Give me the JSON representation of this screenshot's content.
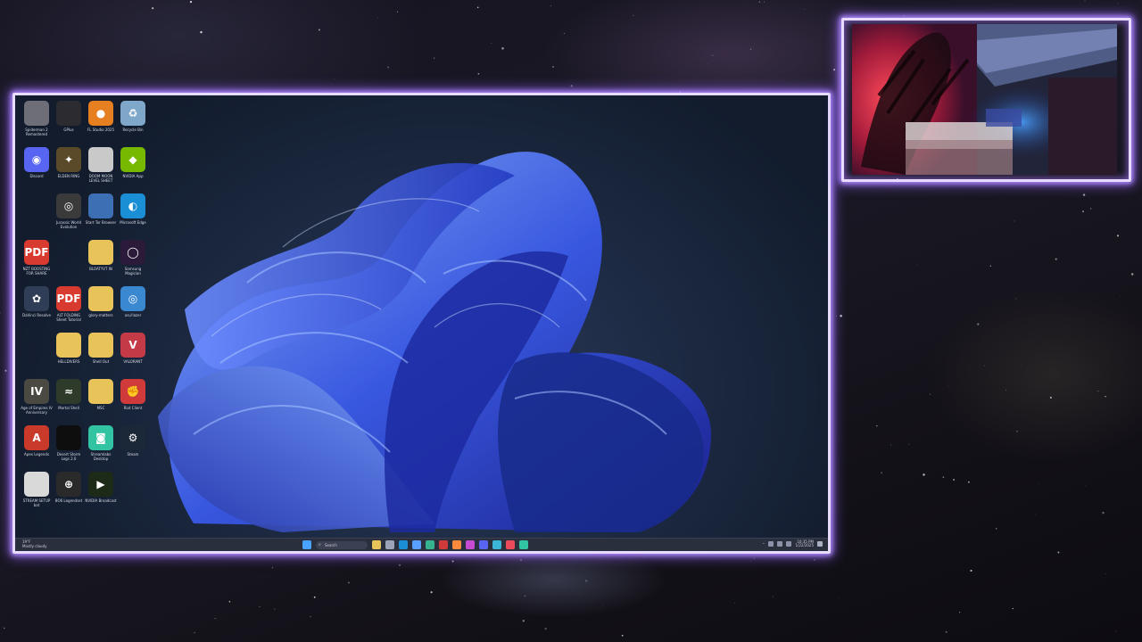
{
  "desktop": {
    "icons": [
      {
        "id": "icon-r1c1",
        "label": "Spiderman 2 Remastered",
        "glyph": "",
        "color": "#6e6e78"
      },
      {
        "id": "icon-r1c2",
        "label": "GPlus",
        "glyph": "",
        "color": "#2c2c30"
      },
      {
        "id": "icon-r1c3",
        "label": "FL Studio 2025",
        "glyph": "●",
        "color": "#e57f1f"
      },
      {
        "id": "icon-r1c4",
        "label": "Recycle Bin",
        "glyph": "♻",
        "color": "#7fa7c9"
      },
      {
        "id": "icon-r2c1",
        "label": "Discord",
        "glyph": "◉",
        "color": "#5865f2"
      },
      {
        "id": "icon-r2c2",
        "label": "ELDEN RING",
        "glyph": "✦",
        "color": "#5a4a2a"
      },
      {
        "id": "icon-r2c3",
        "label": "DOOM MOON LEVEL SHEET",
        "glyph": "",
        "color": "#c9c9c9"
      },
      {
        "id": "icon-r2c4",
        "label": "NVIDIA App",
        "glyph": "◆",
        "color": "#76b900"
      },
      {
        "id": "icon-r3c2",
        "label": "Jurassic World Evolution",
        "glyph": "◎",
        "color": "#3a3a3a"
      },
      {
        "id": "icon-r3c3",
        "label": "Start Tor Browser",
        "glyph": "",
        "color": "#3c6fb4"
      },
      {
        "id": "icon-r3c4",
        "label": "Microsoft Edge",
        "glyph": "◐",
        "color": "#1a8fd6"
      },
      {
        "id": "icon-r4c1",
        "label": "NZT BOOSTING FOR SHARE",
        "glyph": "PDF",
        "color": "#d93a2f"
      },
      {
        "id": "icon-r4c3",
        "label": "BLOATYVT IN",
        "glyph": "",
        "color": "#e8c35a"
      },
      {
        "id": "icon-r4c4",
        "label": "Samsung Magician",
        "glyph": "◯",
        "color": "#2b1a3a"
      },
      {
        "id": "icon-r5c1",
        "label": "DaVinci Resolve",
        "glyph": "✿",
        "color": "#2f3e56"
      },
      {
        "id": "icon-r5c2",
        "label": "ALT FOLDING Sheet Tutorial",
        "glyph": "PDF",
        "color": "#d93a2f"
      },
      {
        "id": "icon-r5c3",
        "label": "glory-matters",
        "glyph": "",
        "color": "#e8c35a"
      },
      {
        "id": "icon-r5c4",
        "label": "osu!lazer",
        "glyph": "◎",
        "color": "#3a88d0"
      },
      {
        "id": "icon-r6c2",
        "label": "HELLDIVERS",
        "glyph": "",
        "color": "#e8c35a"
      },
      {
        "id": "icon-r6c3",
        "label": "Shell Out",
        "glyph": "",
        "color": "#e8c35a"
      },
      {
        "id": "icon-r6c4",
        "label": "VALORANT",
        "glyph": "V",
        "color": "#c43a47"
      },
      {
        "id": "icon-r7c1",
        "label": "Age of Empires IV Anniversary Edition",
        "glyph": "IV",
        "color": "#4a4a42"
      },
      {
        "id": "icon-r7c2",
        "label": "Mortal Shell",
        "glyph": "≈",
        "color": "#2f3b2a"
      },
      {
        "id": "icon-r7c3",
        "label": "MSC",
        "glyph": "",
        "color": "#e8c35a"
      },
      {
        "id": "icon-r7c4",
        "label": "Riot Client",
        "glyph": "✊",
        "color": "#d13a3a"
      },
      {
        "id": "icon-r8c1",
        "label": "Apex Legends",
        "glyph": "A",
        "color": "#c93a2a"
      },
      {
        "id": "icon-r8c2",
        "label": "Desert Storm Legs 2.0",
        "glyph": "",
        "color": "#0e0e0e"
      },
      {
        "id": "icon-r8c3",
        "label": "Streamlabs Desktop",
        "glyph": "◙",
        "color": "#31c3a2"
      },
      {
        "id": "icon-r8c4",
        "label": "Steam",
        "glyph": "⚙",
        "color": "#1b2838"
      },
      {
        "id": "icon-r9c1",
        "label": "STREAM SETUP bat",
        "glyph": "",
        "color": "#d9d9d9"
      },
      {
        "id": "icon-r9c2",
        "label": "BO6 Legendset",
        "glyph": "⊕",
        "color": "#2a2a2a"
      },
      {
        "id": "icon-r9c3",
        "label": "NVIDIA Broadcast",
        "glyph": "▶",
        "color": "#1d2a18"
      }
    ]
  },
  "taskbar": {
    "weather_temp": "19°F",
    "weather_desc": "Mostly cloudy",
    "search_placeholder": "Search",
    "pinned_apps": [
      {
        "name": "start-button",
        "color": "#4aa3ff"
      },
      {
        "name": "file-explorer",
        "color": "#e8c35a"
      },
      {
        "name": "task-view",
        "color": "#9aa3b8"
      },
      {
        "name": "edge",
        "color": "#1a8fd6"
      },
      {
        "name": "app-1",
        "color": "#5aa0ff"
      },
      {
        "name": "app-2",
        "color": "#36b28f"
      },
      {
        "name": "app-3",
        "color": "#d13a3a"
      },
      {
        "name": "app-4",
        "color": "#ff8a3c"
      },
      {
        "name": "app-5",
        "color": "#c54bd0"
      },
      {
        "name": "app-6",
        "color": "#5865f2"
      },
      {
        "name": "app-7",
        "color": "#3bb6d6"
      },
      {
        "name": "app-8",
        "color": "#ea4a5a"
      },
      {
        "name": "app-9",
        "color": "#31c3a2"
      }
    ],
    "clock_time": "10:35 PM",
    "clock_date": "1/22/2025"
  },
  "colors": {
    "neon_border": "#e7dcff",
    "neon_glow": "#b08cff"
  }
}
